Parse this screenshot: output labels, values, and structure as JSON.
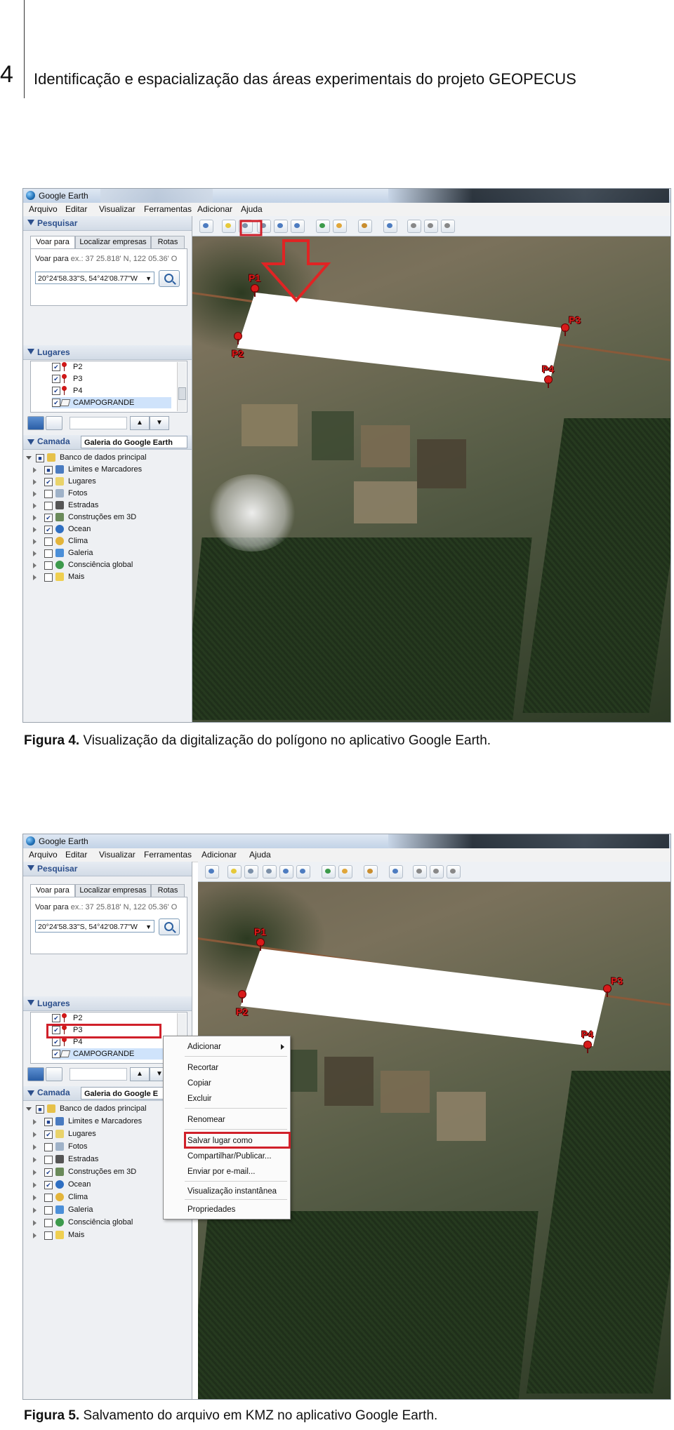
{
  "header": {
    "page_number": "4",
    "title": "Identificação e espacialização das áreas experimentais do projeto GEOPECUS"
  },
  "app": {
    "window_title": "Google Earth",
    "menu": [
      "Arquivo",
      "Editar",
      "Visualizar",
      "Ferramentas",
      "Adicionar",
      "Ajuda"
    ],
    "search": {
      "section_label": "Pesquisar",
      "tabs": [
        "Voar para",
        "Localizar empresas",
        "Rotas"
      ],
      "hint_label": "Voar para",
      "hint_example": "ex.: 37 25.818' N, 122 05.36' O",
      "coordinate_value": "20°24'58.33\"S, 54°42'08.77\"W"
    },
    "places": {
      "section_label": "Lugares",
      "items": [
        "P2",
        "P3",
        "P4",
        "CAMPOGRANDE"
      ]
    },
    "layers": {
      "section_label": "Camada",
      "gallery_label": "Galeria do Google Earth",
      "gallery_label_short": "Galeria do Google E",
      "root": "Banco de dados principal",
      "items": [
        "Limites e Marcadores",
        "Lugares",
        "Fotos",
        "Estradas",
        "Construções em 3D",
        "Ocean",
        "Clima",
        "Galeria",
        "Consciência global",
        "Mais"
      ]
    },
    "markers": [
      "P1",
      "P2",
      "P3",
      "P4"
    ]
  },
  "context_menu": {
    "items": [
      "Adicionar",
      "Recortar",
      "Copiar",
      "Excluir",
      "Renomear",
      "Salvar lugar como",
      "Compartilhar/Publicar...",
      "Enviar por e-mail...",
      "Visualização instantânea",
      "Propriedades"
    ],
    "highlighted": "Salvar lugar como"
  },
  "captions": {
    "fig4_label": "Figura 4.",
    "fig4_text": " Visualização da digitalização do polígono no aplicativo Google Earth.",
    "fig5_label": "Figura 5.",
    "fig5_text": " Salvamento do arquivo em KMZ no aplicativo Google Earth."
  },
  "colors": {
    "highlight": "#d0202a",
    "marker": "#d81a1a",
    "selection": "#cfe3fb"
  }
}
